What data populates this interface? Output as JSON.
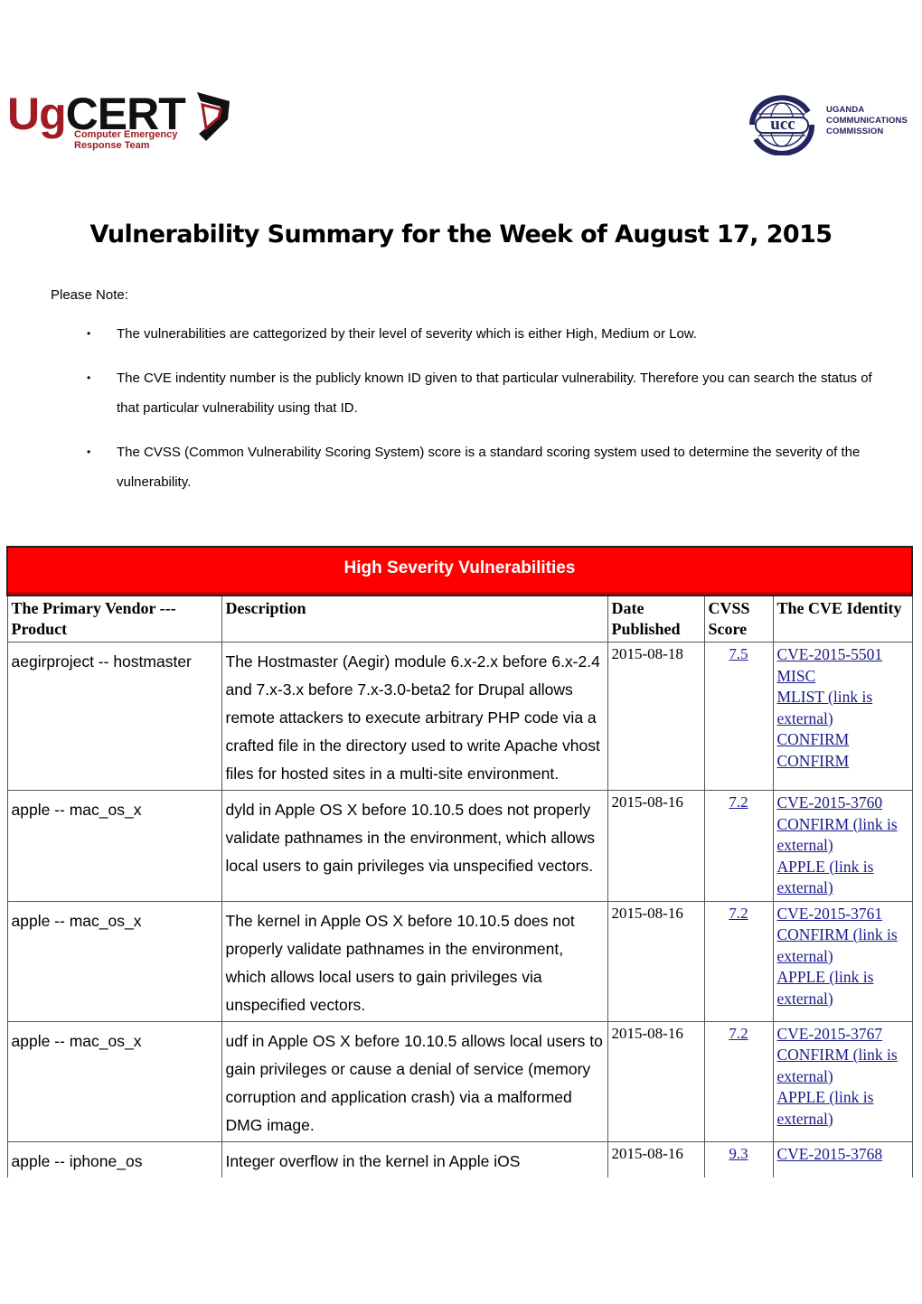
{
  "header": {
    "left_logo": {
      "brand_prefix": "Ug",
      "brand_suffix": "CERT",
      "tagline_line1": "Computer Emergency",
      "tagline_line2": "Response Team",
      "colors": {
        "primary": "#a01c22",
        "secondary": "#111111"
      }
    },
    "right_logo": {
      "globe_text": "ucc",
      "line1": "UGANDA",
      "line2": "COMMUNICATIONS",
      "line3": "COMMISSION",
      "color": "#23265e"
    }
  },
  "document": {
    "title": "Vulnerability Summary for the Week of August 17, 2015",
    "note_label": "Please Note:",
    "notes": [
      "The vulnerabilities are cattegorized by their level of severity which is either High, Medium or Low.",
      "The CVE indentity number is the publicly known ID given to that particular vulnerability. Therefore you can search the status of that particular vulnerability using that ID.",
      "The CVSS (Common Vulnerability Scoring System) score is a standard  scoring system used to determine the severity of the vulnerability."
    ],
    "bullet": "•"
  },
  "table": {
    "section_title": "High Severity Vulnerabilities",
    "section_color": "#ff0000",
    "columns": [
      "The Primary Vendor --- Product",
      "Description",
      "Date Published",
      "CVSS Score",
      "The CVE Identity"
    ],
    "rows": [
      {
        "vendor": "aegirproject -- hostmaster",
        "description": "The Hostmaster (Aegir) module 6.x-2.x before 6.x-2.4 and 7.x-3.x before 7.x-3.0-beta2 for Drupal allows remote attackers to execute arbitrary PHP code via a crafted file in the directory used to write Apache vhost files for hosted sites in a multi-site environment.",
        "date": "2015-08-18",
        "score": "7.5",
        "refs": [
          "CVE-2015-5501",
          "MISC",
          "MLIST (link is external)",
          "CONFIRM",
          "CONFIRM"
        ]
      },
      {
        "vendor": "apple -- mac_os_x",
        "description": "dyld in Apple OS X before 10.10.5 does not properly validate pathnames in the environment, which allows local users to gain privileges via unspecified vectors.",
        "date": "2015-08-16",
        "score": "7.2",
        "refs": [
          "CVE-2015-3760",
          "CONFIRM (link is external)",
          "APPLE (link is external)"
        ]
      },
      {
        "vendor": "apple -- mac_os_x",
        "description": "The kernel in Apple OS X before 10.10.5 does not properly validate pathnames in the environment, which allows local users to gain privileges via unspecified vectors.",
        "date": "2015-08-16",
        "score": "7.2",
        "refs": [
          "CVE-2015-3761",
          "CONFIRM (link is external)",
          "APPLE (link is external)"
        ]
      },
      {
        "vendor": "apple -- mac_os_x",
        "description": "udf in Apple OS X before 10.10.5 allows local users to gain privileges or cause a denial of service (memory corruption and application crash) via a malformed DMG image.",
        "date": "2015-08-16",
        "score": "7.2",
        "refs": [
          "CVE-2015-3767",
          "CONFIRM (link is external)",
          "APPLE (link is external)"
        ]
      },
      {
        "vendor": "apple -- iphone_os",
        "description": "Integer overflow in the kernel in Apple iOS",
        "date": "2015-08-16",
        "score": "9.3",
        "refs": [
          "CVE-2015-3768"
        ]
      }
    ]
  }
}
